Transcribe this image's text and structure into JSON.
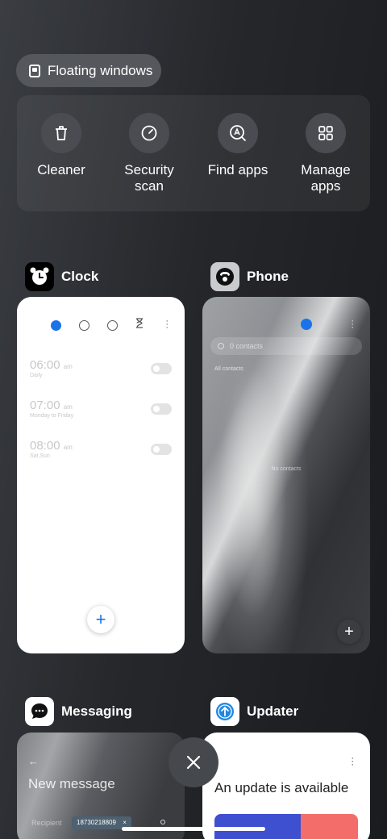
{
  "floating_windows": {
    "label": "Floating windows",
    "icon": "floating-window-icon"
  },
  "quick_actions": [
    {
      "label": "Cleaner",
      "icon": "trash-icon"
    },
    {
      "label": "Security\nscan",
      "icon": "security-scan-icon"
    },
    {
      "label": "Find apps",
      "icon": "find-apps-icon"
    },
    {
      "label": "Manage\napps",
      "icon": "grid-icon"
    }
  ],
  "apps": {
    "clock": {
      "name": "Clock",
      "alarms": [
        {
          "time": "06:00",
          "ampm": "am",
          "repeat": "Daily"
        },
        {
          "time": "07:00",
          "ampm": "am",
          "repeat": "Monday to Friday"
        },
        {
          "time": "08:00",
          "ampm": "am",
          "repeat": "Sat,Sun"
        }
      ]
    },
    "phone": {
      "name": "Phone",
      "search_placeholder": "0 contacts",
      "filter": "All contacts",
      "empty": "No contacts"
    },
    "messaging": {
      "name": "Messaging",
      "title": "New message",
      "recipient_label": "Recipient",
      "recipient": "18730218809"
    },
    "updater": {
      "name": "Updater",
      "title": "An update is available"
    }
  },
  "colors": {
    "accent": "#1a73e8",
    "card_bg": "#ffffff",
    "updater_blue": "#3e4fd0",
    "updater_coral": "#f36d6a"
  }
}
